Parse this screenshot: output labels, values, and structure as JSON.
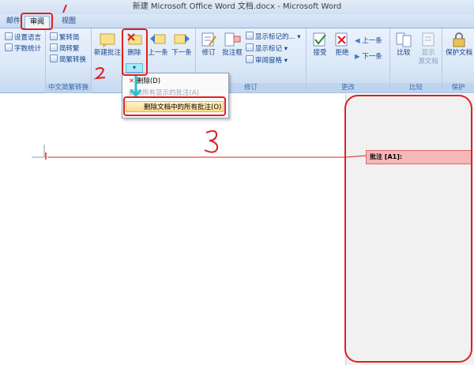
{
  "window": {
    "title": "新建 Microsoft Office Word 文档.docx - Microsoft Word"
  },
  "tabs": [
    {
      "label": "邮件"
    },
    {
      "label": "审阅"
    },
    {
      "label": "视图"
    }
  ],
  "ribbon": {
    "chinese_convert": {
      "label": "中文简繁转换",
      "left_items": [
        "设置语言",
        "字数统计"
      ],
      "items": [
        "繁转简",
        "简转繁",
        "简繁转换"
      ]
    },
    "comments": {
      "new_comment": "新建批注",
      "delete": "删除",
      "prev": "上一条",
      "next": "下一条"
    },
    "tracking": {
      "label": "修订",
      "track_changes": "修订",
      "balloons": "批注框",
      "display_for_review": "显示标记的...",
      "show_markup": "显示标记",
      "reviewing_pane": "审阅窗格"
    },
    "changes": {
      "label": "更改",
      "accept": "接受",
      "reject": "拒绝",
      "prev": "上一条",
      "next": "下一条"
    },
    "compare": {
      "label": "比较",
      "compare": "比较",
      "show_source": "显示",
      "source_docs": "源文档"
    },
    "protect": {
      "label": "保护",
      "protect_doc": "保护文档"
    }
  },
  "delete_menu": {
    "item_delete": "删除(D)",
    "item_delete_shown": "删除所有显示的批注(A)",
    "item_delete_all": "删除文档中的所有批注(O)"
  },
  "document": {
    "comment_text": "批注 [A1]:"
  },
  "annotations": {
    "step1": "1",
    "step2": "2",
    "step3": "3"
  },
  "colors": {
    "annotation": "#e02020",
    "ribbon_bg": "#dbe8f7",
    "comment_fill": "#f6b7b7"
  }
}
